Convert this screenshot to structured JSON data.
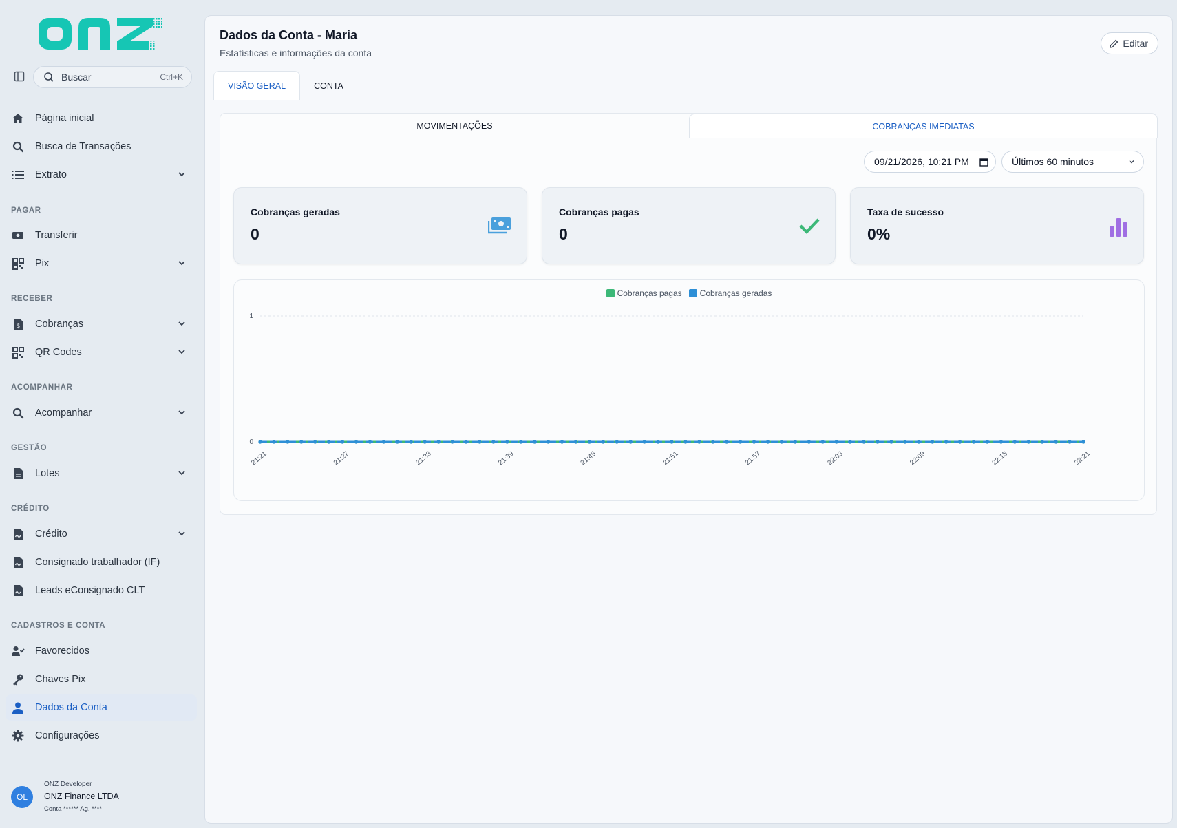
{
  "brand": {
    "logo_text": "onz",
    "accent": "#16c6b4"
  },
  "search": {
    "label": "Buscar",
    "shortcut": "Ctrl+K"
  },
  "nav": {
    "home": "Página inicial",
    "tx_search": "Busca de Transações",
    "extrato": "Extrato",
    "sec_pagar": "PAGAR",
    "transferir": "Transferir",
    "pix": "Pix",
    "sec_receber": "RECEBER",
    "cobrancas": "Cobranças",
    "qrcodes": "QR Codes",
    "sec_acompanhar": "ACOMPANHAR",
    "acompanhar": "Acompanhar",
    "sec_gestao": "GESTÃO",
    "lotes": "Lotes",
    "sec_credito": "CRÉDITO",
    "credito": "Crédito",
    "consignado": "Consignado trabalhador (IF)",
    "leads": "Leads eConsignado CLT",
    "sec_cadastros": "CADASTROS E CONTA",
    "favorecidos": "Favorecidos",
    "chaves": "Chaves Pix",
    "dados": "Dados da Conta",
    "config": "Configurações"
  },
  "user": {
    "initials": "OL",
    "role": "ONZ Developer",
    "company": "ONZ Finance LTDA",
    "account": "Conta ****** Ag. ****"
  },
  "header": {
    "title": "Dados da Conta - Maria",
    "subtitle": "Estatísticas e informações da conta",
    "edit": "Editar"
  },
  "tabs": {
    "overview": "VISÃO GERAL",
    "account": "CONTA"
  },
  "subtabs": {
    "movs": "MOVIMENTAÇÕES",
    "cob": "COBRANÇAS IMEDIATAS"
  },
  "filters": {
    "date": "09/21/2026, 10:21 PM",
    "range": "Últimos 60 minutos"
  },
  "cards": {
    "generated_title": "Cobranças geradas",
    "generated_value": "0",
    "paid_title": "Cobranças pagas",
    "paid_value": "0",
    "rate_title": "Taxa de sucesso",
    "rate_value": "0%"
  },
  "colors": {
    "paid": "#3cb878",
    "generated": "#2e8fd6",
    "rate_icon": "#a06fe3",
    "money_icon": "#4aa0dc"
  },
  "chart_data": {
    "type": "line",
    "legend_position": "top-center",
    "grid": "horizontal-dashed",
    "ylim": [
      0,
      1
    ],
    "yticks": [
      "0",
      "1"
    ],
    "xticks": [
      "21:21",
      "21:27",
      "21:33",
      "21:39",
      "21:45",
      "21:51",
      "21:57",
      "22:03",
      "22:09",
      "22:15",
      "22:21"
    ],
    "x": [
      "21:21",
      "21:22",
      "21:23",
      "21:24",
      "21:25",
      "21:26",
      "21:27",
      "21:28",
      "21:29",
      "21:30",
      "21:31",
      "21:32",
      "21:33",
      "21:34",
      "21:35",
      "21:36",
      "21:37",
      "21:38",
      "21:39",
      "21:40",
      "21:41",
      "21:42",
      "21:43",
      "21:44",
      "21:45",
      "21:46",
      "21:47",
      "21:48",
      "21:49",
      "21:50",
      "21:51",
      "21:52",
      "21:53",
      "21:54",
      "21:55",
      "21:56",
      "21:57",
      "21:58",
      "21:59",
      "22:00",
      "22:01",
      "22:02",
      "22:03",
      "22:04",
      "22:05",
      "22:06",
      "22:07",
      "22:08",
      "22:09",
      "22:10",
      "22:11",
      "22:12",
      "22:13",
      "22:14",
      "22:15",
      "22:16",
      "22:17",
      "22:18",
      "22:19",
      "22:20",
      "22:21"
    ],
    "series": [
      {
        "name": "Cobranças pagas",
        "color": "#3cb878",
        "values": [
          0,
          0,
          0,
          0,
          0,
          0,
          0,
          0,
          0,
          0,
          0,
          0,
          0,
          0,
          0,
          0,
          0,
          0,
          0,
          0,
          0,
          0,
          0,
          0,
          0,
          0,
          0,
          0,
          0,
          0,
          0,
          0,
          0,
          0,
          0,
          0,
          0,
          0,
          0,
          0,
          0,
          0,
          0,
          0,
          0,
          0,
          0,
          0,
          0,
          0,
          0,
          0,
          0,
          0,
          0,
          0,
          0,
          0,
          0,
          0,
          0
        ]
      },
      {
        "name": "Cobranças geradas",
        "color": "#2e8fd6",
        "values": [
          0,
          0,
          0,
          0,
          0,
          0,
          0,
          0,
          0,
          0,
          0,
          0,
          0,
          0,
          0,
          0,
          0,
          0,
          0,
          0,
          0,
          0,
          0,
          0,
          0,
          0,
          0,
          0,
          0,
          0,
          0,
          0,
          0,
          0,
          0,
          0,
          0,
          0,
          0,
          0,
          0,
          0,
          0,
          0,
          0,
          0,
          0,
          0,
          0,
          0,
          0,
          0,
          0,
          0,
          0,
          0,
          0,
          0,
          0,
          0,
          0
        ]
      }
    ]
  }
}
